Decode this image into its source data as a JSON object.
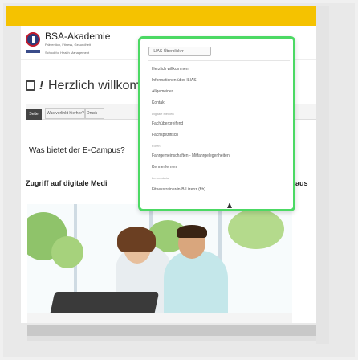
{
  "header": {
    "logo_title": "BSA-Akademie",
    "logo_subtitle": "Prävention, Fitness, Gesundheit",
    "logo_subtitle2": "School for Health Management"
  },
  "main": {
    "page_title": "Herzlich willkom",
    "tabs": [
      {
        "label": "Seite"
      },
      {
        "label": "Was verlinkt hierher?"
      },
      {
        "label": "Druck"
      }
    ],
    "question": "Was bietet der E-Campus?",
    "subheading": "Zugriff auf digitale Medi",
    "subheading_end": "aus"
  },
  "menu": {
    "dropdown_label": "ILIAS-Überblick ▾",
    "items": [
      {
        "label": "Herzlich willkommen"
      },
      {
        "label": "Informationen über ILIAS"
      },
      {
        "label": "Allgemeines"
      },
      {
        "label": "Kontakt"
      },
      {
        "label": "Digitale Medien",
        "section": true
      },
      {
        "label": "Fachübergreifend"
      },
      {
        "label": "Fachspezifisch"
      },
      {
        "label": "Foren",
        "section": true
      },
      {
        "label": "Fahrgemeinschaften - Mitfahrgelegenheiten"
      },
      {
        "label": "Kennenlernen"
      },
      {
        "label": "Lernmaterial",
        "section": true
      },
      {
        "label": "Fitnesstrainer/in-B-Lizenz (ftb)"
      }
    ]
  },
  "colors": {
    "topbar": "#f5c200",
    "menu_border": "#4cd964",
    "logo_blue": "#2e3c7a",
    "logo_red": "#c31b2c"
  }
}
